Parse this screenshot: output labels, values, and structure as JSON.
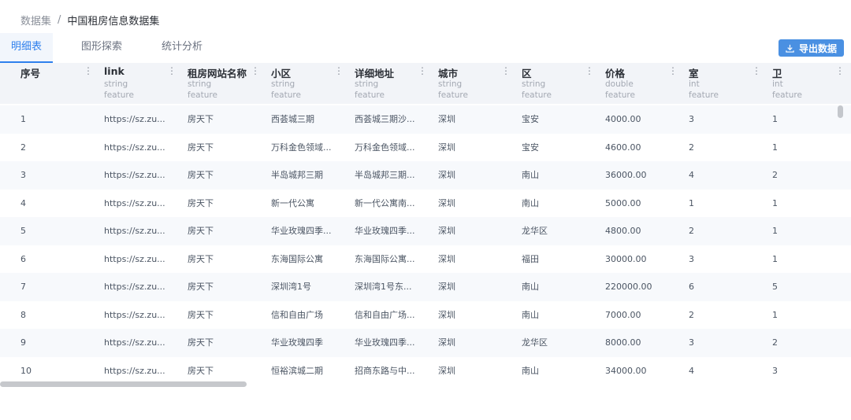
{
  "breadcrumb": {
    "root": "数据集",
    "separator": "/",
    "current": "中国租房信息数据集"
  },
  "tabs": [
    {
      "label": "明细表",
      "active": true
    },
    {
      "label": "图形探索",
      "active": false
    },
    {
      "label": "统计分析",
      "active": false
    }
  ],
  "export_button": {
    "label": "导出数据",
    "icon": "download-icon"
  },
  "colors": {
    "accent": "#2f80ed",
    "button": "#4a90e2",
    "header_bg": "#f2f4f8"
  },
  "columns": [
    {
      "name": "序号",
      "type": "",
      "role": ""
    },
    {
      "name": "link",
      "type": "string",
      "role": "feature"
    },
    {
      "name": "租房网站名称",
      "type": "string",
      "role": "feature"
    },
    {
      "name": "小区",
      "type": "string",
      "role": "feature"
    },
    {
      "name": "详细地址",
      "type": "string",
      "role": "feature"
    },
    {
      "name": "城市",
      "type": "string",
      "role": "feature"
    },
    {
      "name": "区",
      "type": "string",
      "role": "feature"
    },
    {
      "name": "价格",
      "type": "double",
      "role": "feature"
    },
    {
      "name": "室",
      "type": "int",
      "role": "feature"
    },
    {
      "name": "卫",
      "type": "int",
      "role": "feature"
    }
  ],
  "column_menu_icon": "more-vertical-icon",
  "rows": [
    [
      "1",
      "https://sz.zu...",
      "房天下",
      "西荟城三期",
      "西荟城三期沙...",
      "深圳",
      "宝安",
      "4000.00",
      "3",
      "1"
    ],
    [
      "2",
      "https://sz.zu...",
      "房天下",
      "万科金色领域...",
      "万科金色领域...",
      "深圳",
      "宝安",
      "4600.00",
      "2",
      "1"
    ],
    [
      "3",
      "https://sz.zu...",
      "房天下",
      "半岛城邦三期",
      "半岛城邦三期...",
      "深圳",
      "南山",
      "36000.00",
      "4",
      "2"
    ],
    [
      "4",
      "https://sz.zu...",
      "房天下",
      "新一代公寓",
      "新一代公寓南...",
      "深圳",
      "南山",
      "5000.00",
      "1",
      "1"
    ],
    [
      "5",
      "https://sz.zu...",
      "房天下",
      "华业玫瑰四季...",
      "华业玫瑰四季...",
      "深圳",
      "龙华区",
      "4800.00",
      "2",
      "1"
    ],
    [
      "6",
      "https://sz.zu...",
      "房天下",
      "东海国际公寓",
      "东海国际公寓...",
      "深圳",
      "福田",
      "30000.00",
      "3",
      "1"
    ],
    [
      "7",
      "https://sz.zu...",
      "房天下",
      "深圳湾1号",
      "深圳湾1号东...",
      "深圳",
      "南山",
      "220000.00",
      "6",
      "5"
    ],
    [
      "8",
      "https://sz.zu...",
      "房天下",
      "信和自由广场",
      "信和自由广场...",
      "深圳",
      "南山",
      "7000.00",
      "2",
      "1"
    ],
    [
      "9",
      "https://sz.zu...",
      "房天下",
      "华业玫瑰四季",
      "华业玫瑰四季...",
      "深圳",
      "龙华区",
      "8000.00",
      "3",
      "2"
    ],
    [
      "10",
      "https://sz.zu...",
      "房天下",
      "恒裕滨城二期",
      "招商东路与中...",
      "深圳",
      "南山",
      "34000.00",
      "4",
      "3"
    ]
  ]
}
